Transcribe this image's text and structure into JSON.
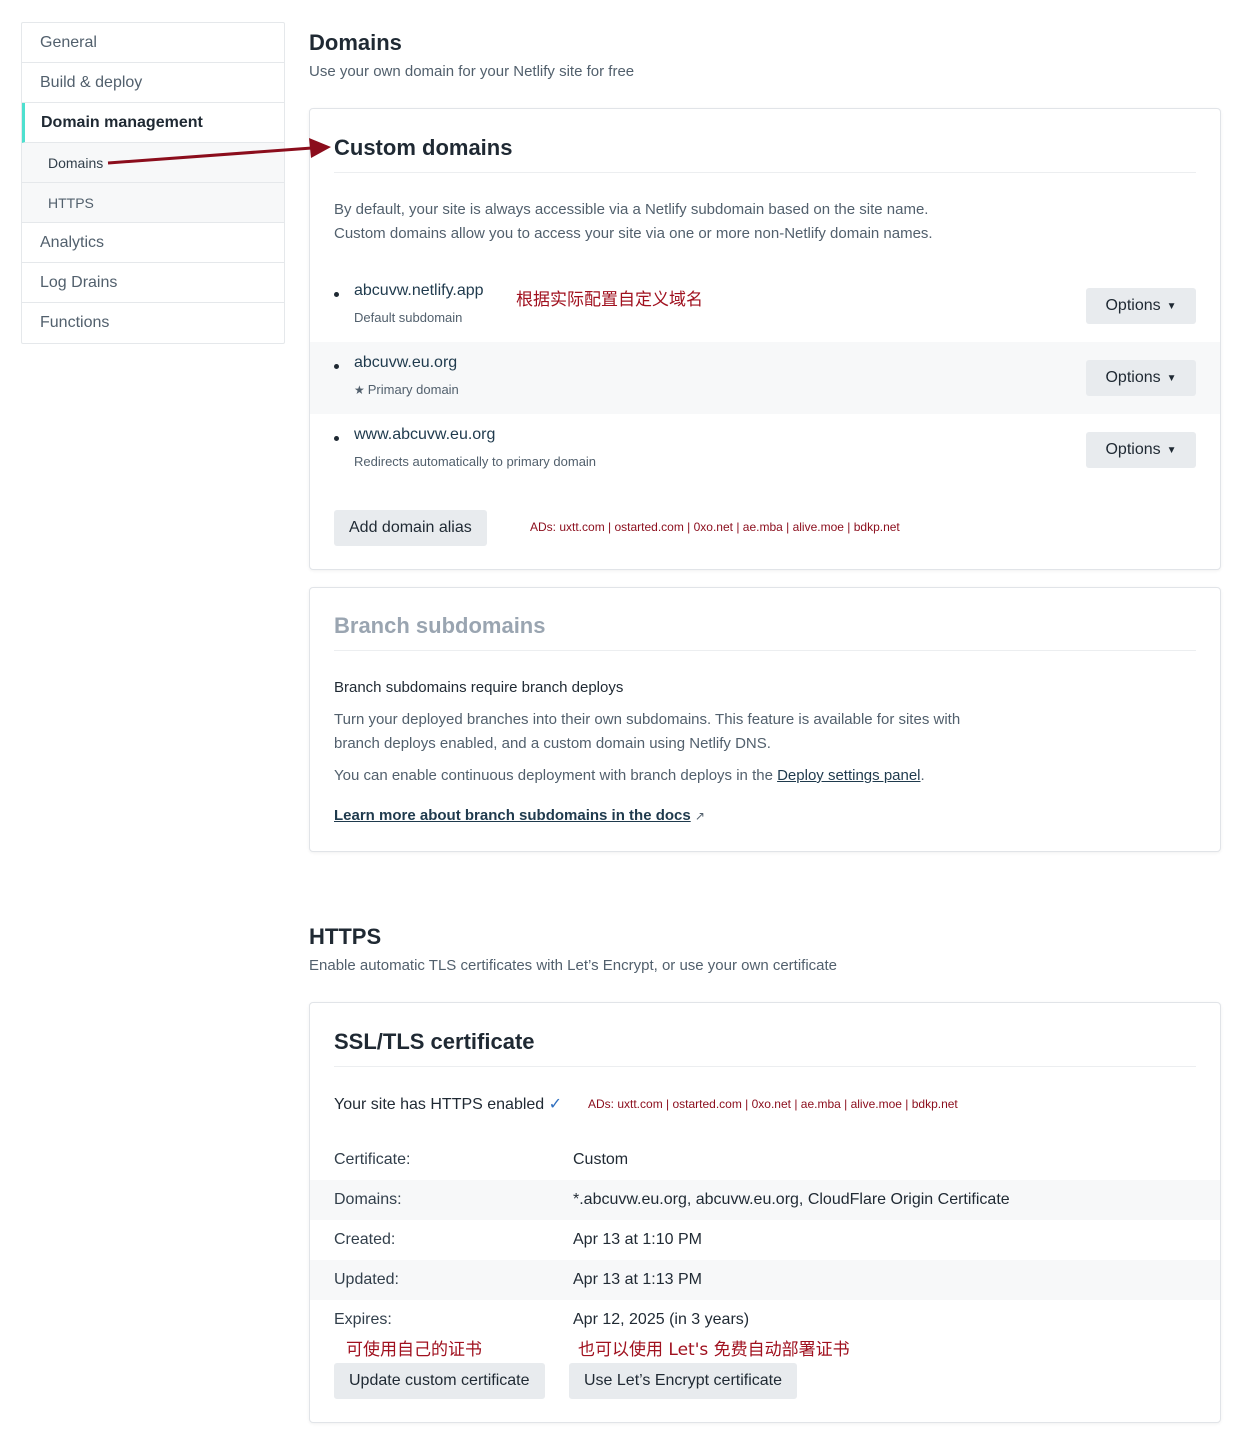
{
  "sidebar": {
    "items": [
      {
        "label": "General"
      },
      {
        "label": "Build & deploy"
      },
      {
        "label": "Domain management"
      },
      {
        "label": "Domains"
      },
      {
        "label": "HTTPS"
      },
      {
        "label": "Analytics"
      },
      {
        "label": "Log Drains"
      },
      {
        "label": "Functions"
      }
    ]
  },
  "domains_section": {
    "title": "Domains",
    "subtitle": "Use your own domain for your Netlify site for free"
  },
  "custom_domains": {
    "title": "Custom domains",
    "desc_line1": "By default, your site is always accessible via a Netlify subdomain based on the site name.",
    "desc_line2": "Custom domains allow you to access your site via one or more non-Netlify domain names.",
    "annotation": "根据实际配置自定义域名",
    "rows": [
      {
        "domain": "abcuvw.netlify.app",
        "note": "Default subdomain",
        "options_label": "Options"
      },
      {
        "domain": "abcuvw.eu.org",
        "note": "Primary domain",
        "options_label": "Options"
      },
      {
        "domain": "www.abcuvw.eu.org",
        "note": "Redirects automatically to primary domain",
        "options_label": "Options"
      }
    ],
    "add_alias_label": "Add domain alias",
    "ads": "ADs:  uxtt.com | ostarted.com | 0xo.net | ae.mba | alive.moe | bdkp.net"
  },
  "branch_subdomains": {
    "title": "Branch subdomains",
    "heading": "Branch subdomains require branch deploys",
    "para1_line1": "Turn your deployed branches into their own subdomains. This feature is available for sites with",
    "para1_line2": "branch deploys enabled, and a custom domain using Netlify DNS.",
    "para2_prefix": "You can enable continuous deployment with branch deploys in the ",
    "para2_link": "Deploy settings panel",
    "para2_suffix": ".",
    "docs_link": "Learn more about branch subdomains in the docs",
    "docs_arrow": "↗"
  },
  "https_section": {
    "title": "HTTPS",
    "subtitle": "Enable automatic TLS certificates with Let’s Encrypt, or use your own certificate"
  },
  "ssl": {
    "title": "SSL/TLS certificate",
    "status": "Your site has HTTPS enabled",
    "check": "✓",
    "ads": "ADs:  uxtt.com | ostarted.com | 0xo.net | ae.mba | alive.moe | bdkp.net",
    "rows": [
      {
        "key": "Certificate:",
        "value": "Custom"
      },
      {
        "key": "Domains:",
        "value": "*.abcuvw.eu.org, abcuvw.eu.org, CloudFlare Origin Certificate"
      },
      {
        "key": "Created:",
        "value": "Apr 13 at 1:10 PM"
      },
      {
        "key": "Updated:",
        "value": "Apr 13 at 1:13 PM"
      },
      {
        "key": "Expires:",
        "value": "Apr 12, 2025 (in 3 years)"
      }
    ],
    "note_custom": "可使用自己的证书",
    "note_letsencrypt": "也可以使用 Let's 免费自动部署证书",
    "update_btn": "Update custom certificate",
    "letsencrypt_btn": "Use Let’s Encrypt certificate"
  },
  "colors": {
    "accent": "#4ee0cf",
    "annotation_red": "#a0111f",
    "arrow_red": "#8b0d1c",
    "button_bg": "#e8ebee",
    "check_blue": "#2f6fbf"
  }
}
